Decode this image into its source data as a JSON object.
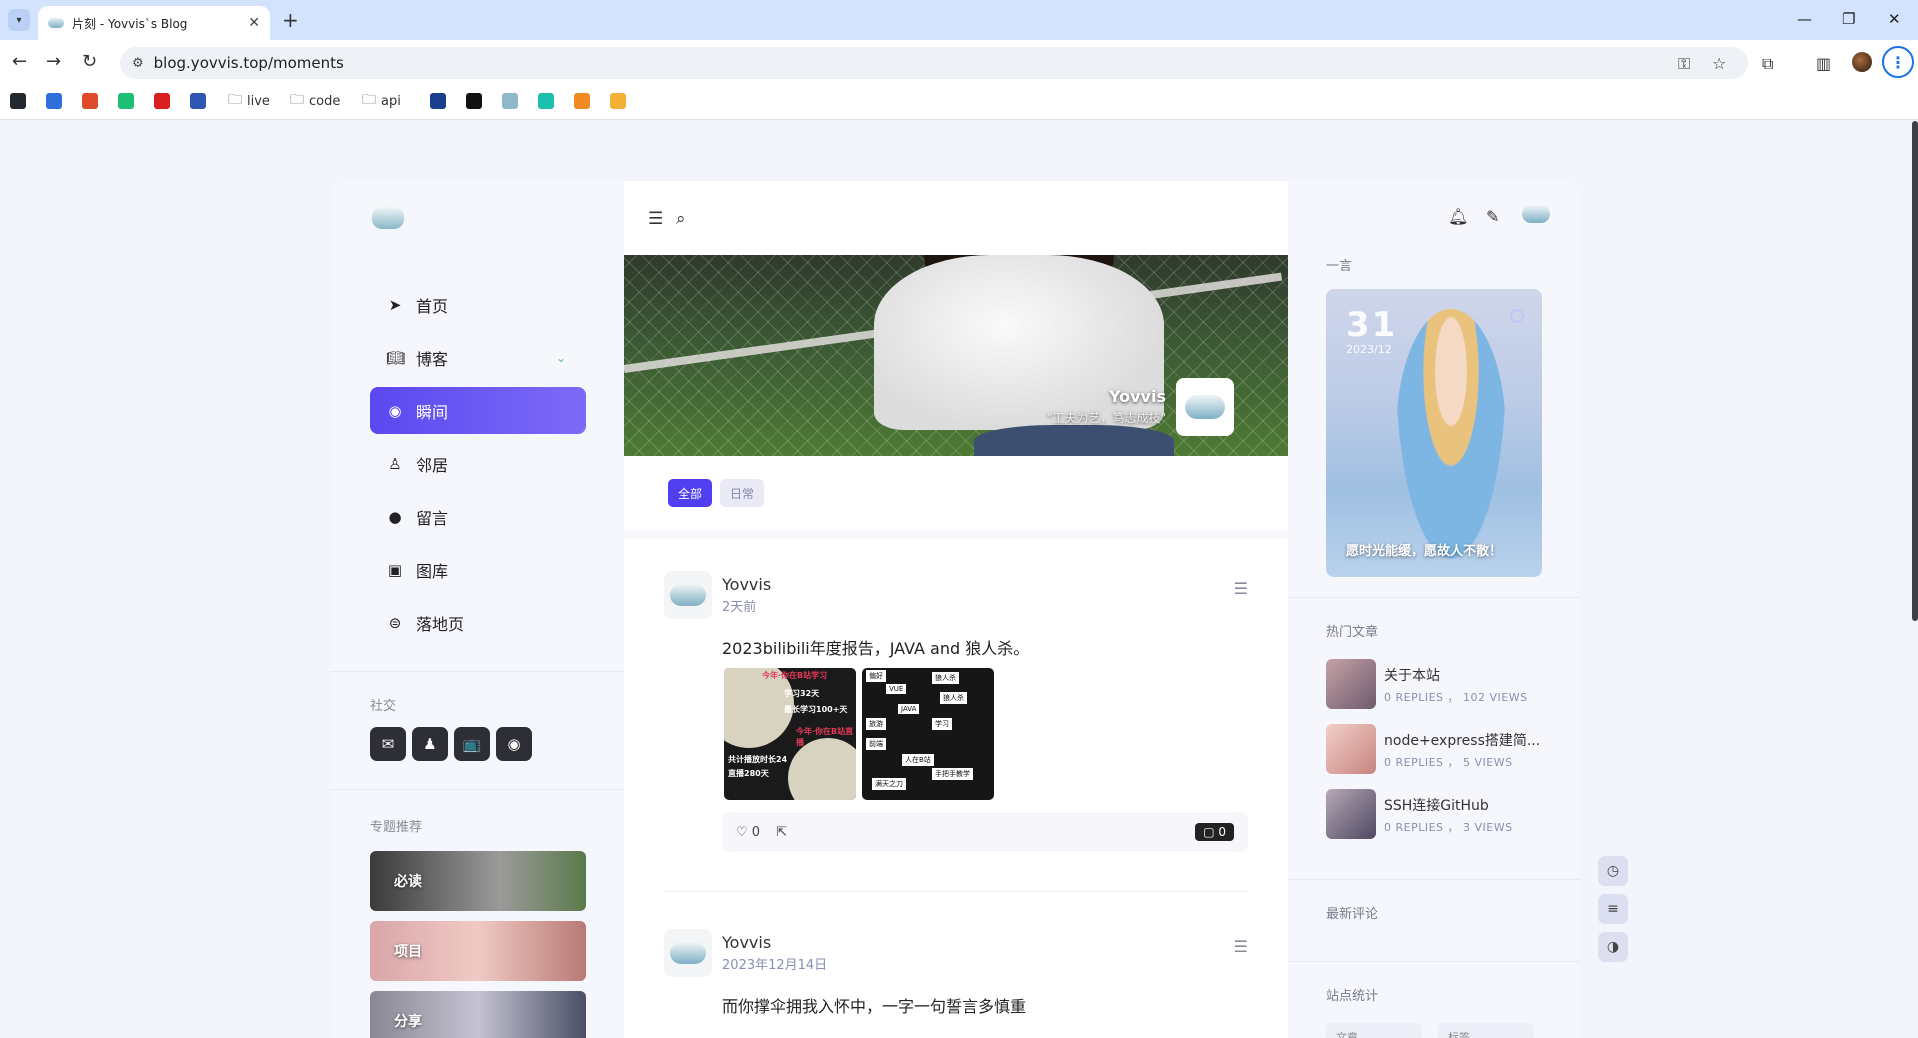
{
  "browser": {
    "tab_title": "片刻 - Yovvis`s Blog",
    "url": "blog.yovvis.top/moments",
    "bookmarks": [
      {
        "label": "",
        "color": "#24292f"
      },
      {
        "label": "",
        "color": "#2f6fdb"
      },
      {
        "label": "",
        "color": "#e04a2c"
      },
      {
        "label": "",
        "color": "#1dbf73"
      },
      {
        "label": "",
        "color": "#d9201e"
      },
      {
        "label": "",
        "color": "#2f56b4"
      },
      {
        "label": "live",
        "folder": true
      },
      {
        "label": "code",
        "folder": true
      },
      {
        "label": "api",
        "folder": true
      },
      {
        "label": "",
        "color": "#1b3f8f"
      },
      {
        "label": "",
        "color": "#111111"
      },
      {
        "label": "",
        "color": "#8fb9c9"
      },
      {
        "label": "",
        "color": "#1fbfb0"
      },
      {
        "label": "",
        "color": "#f08a24"
      },
      {
        "label": "",
        "color": "#f2b134"
      }
    ]
  },
  "sidebar": {
    "nav": [
      {
        "label": "首页",
        "icon": "navigation-arrow-icon"
      },
      {
        "label": "博客",
        "icon": "book-icon",
        "expandable": true
      },
      {
        "label": "瞬间",
        "icon": "moment-icon",
        "active": true
      },
      {
        "label": "邻居",
        "icon": "neighbor-icon"
      },
      {
        "label": "留言",
        "icon": "message-icon"
      },
      {
        "label": "图库",
        "icon": "image-icon"
      },
      {
        "label": "落地页",
        "icon": "landing-icon"
      }
    ],
    "social_title": "社交",
    "social": [
      "wechat-icon",
      "qq-icon",
      "bilibili-icon",
      "github-icon"
    ],
    "topics_title": "专题推荐",
    "topics": [
      "必读",
      "项目",
      "分享"
    ]
  },
  "banner": {
    "author": "Yovvis",
    "motto": "\"工夫为艺，笃志成技\""
  },
  "filters": [
    "全部",
    "日常"
  ],
  "posts": [
    {
      "author": "Yovvis",
      "time": "2天前",
      "text": "2023bilibili年度报告，JAVA and 狼人杀。",
      "likes": "0",
      "comments": "0",
      "img1": {
        "a": "今年·你在B站学习",
        "b": "学习32天",
        "c": "最长学习100+天",
        "d": "今年·你在B站直播",
        "e": "共计播放时长24",
        "f": "直播280天"
      },
      "img2": [
        "偏好",
        "狼人杀",
        "VUE",
        "狼人杀",
        "JAVA",
        "旅游",
        "学习",
        "前端",
        "人在B站",
        "手把手教学",
        "满天之刀"
      ]
    },
    {
      "author": "Yovvis",
      "time": "2023年12月14日",
      "text": "而你撑伞拥我入怀中，一字一句誓言多慎重"
    }
  ],
  "right": {
    "yiyan_title": "一言",
    "quote": {
      "day": "31",
      "date": "2023/12",
      "text": "愿时光能缓，愿故人不散！"
    },
    "hot_title": "热门文章",
    "hot": [
      {
        "title": "关于本站",
        "meta": "0 REPLIES ， 102 VIEWS"
      },
      {
        "title": "node+express搭建简...",
        "meta": "0 REPLIES ， 5 VIEWS"
      },
      {
        "title": "SSH连接GitHub",
        "meta": "0 REPLIES ， 3 VIEWS"
      }
    ],
    "comments_title": "最新评论",
    "stats_title": "站点统计",
    "stats": [
      "文章",
      "标签"
    ]
  },
  "colors": {
    "accent": "#5b48f0",
    "page_bg": "#f4f4fd"
  }
}
